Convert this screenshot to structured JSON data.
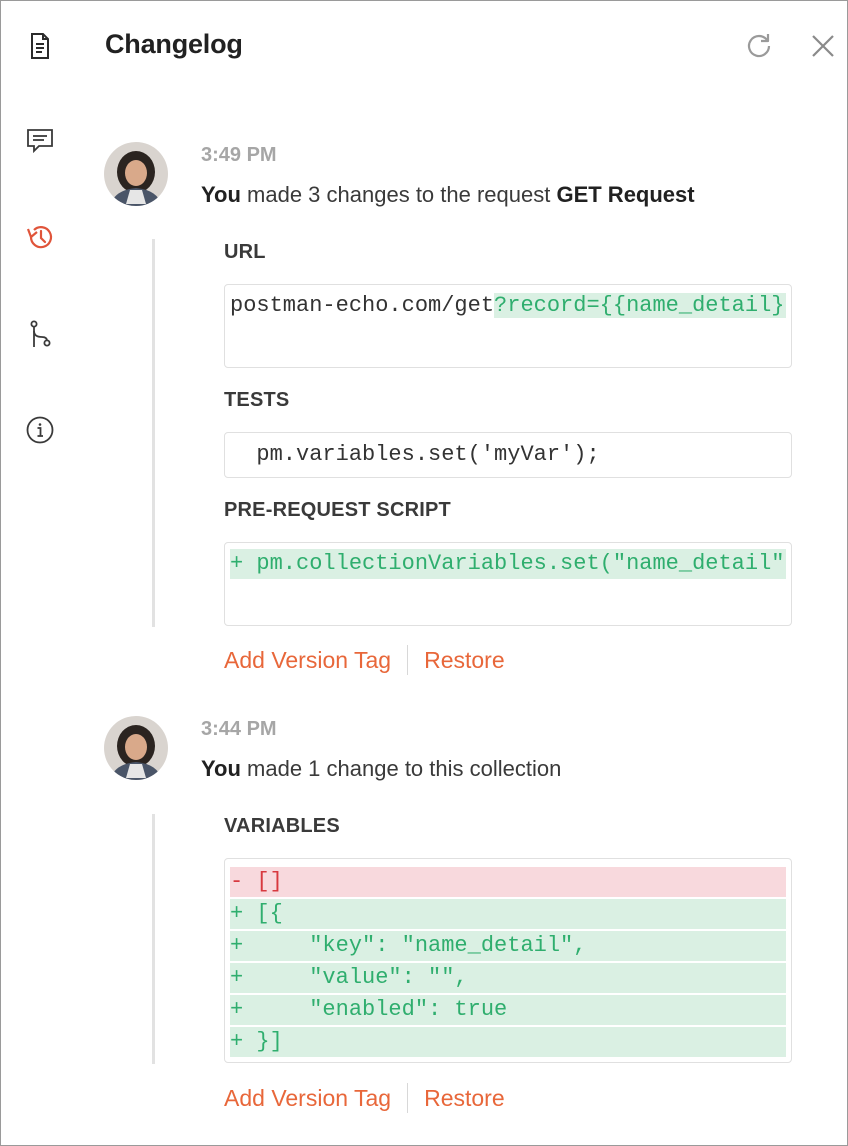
{
  "header": {
    "title": "Changelog",
    "refresh_icon": "refresh-icon",
    "close_icon": "close-icon"
  },
  "rail": {
    "items": [
      {
        "icon": "document-icon",
        "name": "documentation"
      },
      {
        "icon": "comment-icon",
        "name": "comments"
      },
      {
        "icon": "history-icon",
        "name": "changelog",
        "active": true
      },
      {
        "icon": "pull-request-icon",
        "name": "pull-requests"
      },
      {
        "icon": "info-icon",
        "name": "info"
      }
    ]
  },
  "colors": {
    "accent": "#e8673a",
    "added_bg": "#daf0e3",
    "added_text": "#2fae6e",
    "removed_bg": "#f8d9dd",
    "removed_text": "#d8393f"
  },
  "entries": [
    {
      "time": "3:49 PM",
      "actor": "You",
      "summary_mid": " made 3 changes to the request ",
      "target": "GET Request",
      "sections": [
        {
          "label": "URL",
          "lines": [
            {
              "base": "postman-echo.com/get",
              "added": "?record={{name_detail}}"
            }
          ]
        },
        {
          "label": "TESTS",
          "lines": [
            {
              "text": "  pm.variables.set('myVar');"
            }
          ]
        },
        {
          "label": "PRE-REQUEST SCRIPT",
          "lines": [
            {
              "type": "add",
              "text": "+ pm.collectionVariables.set(\"name_detail\");"
            }
          ]
        }
      ],
      "actions": {
        "add_tag": "Add Version Tag",
        "restore": "Restore"
      }
    },
    {
      "time": "3:44 PM",
      "actor": "You",
      "summary_mid": " made 1 change to this collection",
      "target": "",
      "sections": [
        {
          "label": "VARIABLES",
          "lines": [
            {
              "type": "del",
              "text": "- []"
            },
            {
              "type": "add",
              "text": "+ [{"
            },
            {
              "type": "add",
              "text": "+     \"key\": \"name_detail\","
            },
            {
              "type": "add",
              "text": "+     \"value\": \"\","
            },
            {
              "type": "add",
              "text": "+     \"enabled\": true"
            },
            {
              "type": "add",
              "text": "+ }]"
            }
          ]
        }
      ],
      "actions": {
        "add_tag": "Add Version Tag",
        "restore": "Restore"
      }
    }
  ]
}
